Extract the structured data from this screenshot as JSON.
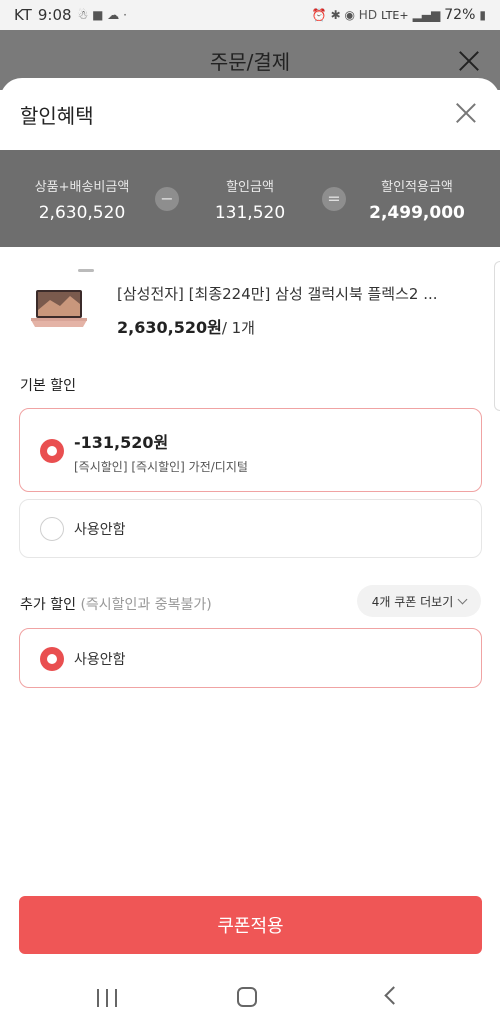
{
  "status_bar": {
    "carrier": "KT",
    "time": "9:08",
    "network": "LTE+",
    "battery": "72%"
  },
  "background_page": {
    "title": "주문/결제"
  },
  "sheet": {
    "title": "할인혜택",
    "summary": {
      "product_shipping_label": "상품+배송비금액",
      "product_shipping_value": "2,630,520",
      "minus_symbol": "−",
      "discount_label": "할인금액",
      "discount_value": "131,520",
      "equals_symbol": "=",
      "final_label": "할인적용금액",
      "final_value": "2,499,000"
    },
    "product": {
      "name": "[삼성전자] [최종224만] 삼성 갤럭시북 플렉스2 ...",
      "price": "2,630,520원",
      "quantity": "/ 1개"
    },
    "basic_discount": {
      "label": "기본 할인",
      "options": [
        {
          "amount": "-131,520원",
          "desc": "[즉시할인] [즉시할인] 가전/디지털",
          "selected": true
        },
        {
          "text": "사용안함",
          "selected": false
        }
      ]
    },
    "extra_discount": {
      "label": "추가 할인",
      "sublabel": "(즉시할인과 중복불가)",
      "more_button": "4개 쿠폰 더보기",
      "options": [
        {
          "text": "사용안함",
          "selected": true
        }
      ]
    },
    "apply_button": "쿠폰적용"
  },
  "colors": {
    "accent": "#ef5656",
    "summary_bg": "#6e6e6e",
    "selected_border": "#f0a3a3"
  }
}
